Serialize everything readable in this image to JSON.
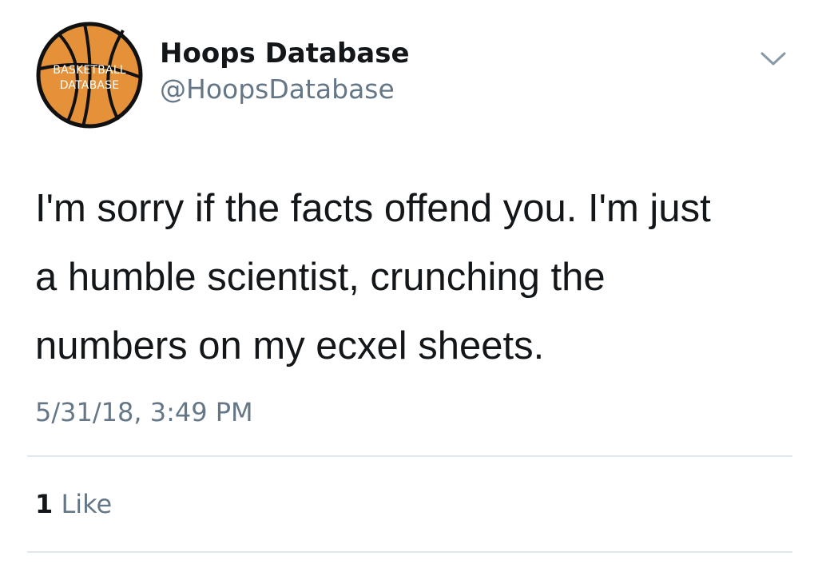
{
  "tweet": {
    "avatar": {
      "line1": "BASKETBALL",
      "line2": "DATABASE",
      "icon": "basketball-icon",
      "ball_color": "#e5913a",
      "seam_color": "#111111"
    },
    "display_name": "Hoops Database",
    "handle": "@HoopsDatabase",
    "menu_icon": "chevron-down-icon",
    "text_lines": [
      "I'm sorry if the facts offend you. I'm just",
      "a humble scientist, crunching the",
      "numbers on my ecxel sheets."
    ],
    "timestamp": "5/31/18, 3:49 PM",
    "likes": {
      "count": "1",
      "label": "Like"
    }
  }
}
